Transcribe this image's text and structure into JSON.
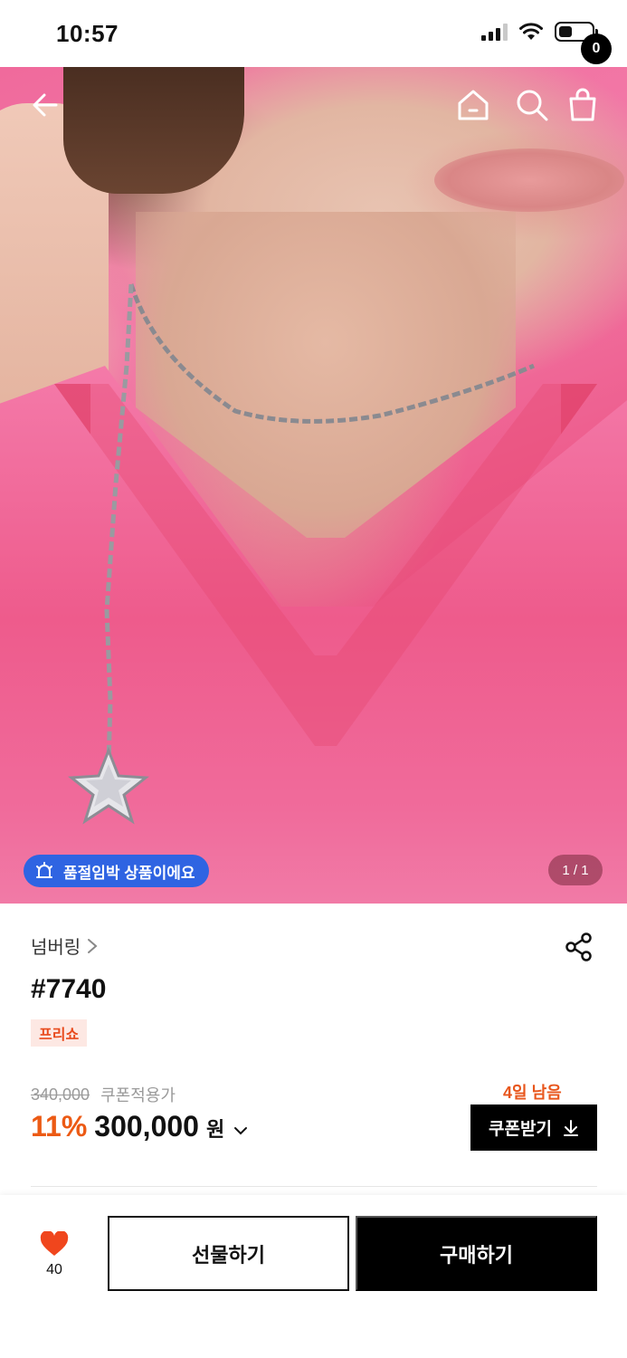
{
  "status_bar": {
    "time": "10:57"
  },
  "header": {
    "back_icon": "arrow-left-icon",
    "home_icon": "home-icon",
    "search_icon": "search-icon",
    "cart_icon": "shopping-bag-icon",
    "cart_count": "0"
  },
  "gallery": {
    "soldout_badge": "품절임박 상품이에요",
    "page_counter": "1 / 1"
  },
  "product": {
    "brand": "넘버링",
    "title": "#7740",
    "tag": "프리쇼",
    "original_price": "340,000",
    "coupon_price_label": "쿠폰적용가",
    "discount": "11%",
    "price": "300,000",
    "price_unit": "원",
    "days_left": "4일 남음",
    "coupon_button": "쿠폰받기"
  },
  "bottom_bar": {
    "like_count": "40",
    "gift_button": "선물하기",
    "buy_button": "구매하기"
  },
  "colors": {
    "accent_orange": "#ec5a14",
    "badge_blue": "#2f64e2",
    "heart_red": "#f0461d"
  }
}
